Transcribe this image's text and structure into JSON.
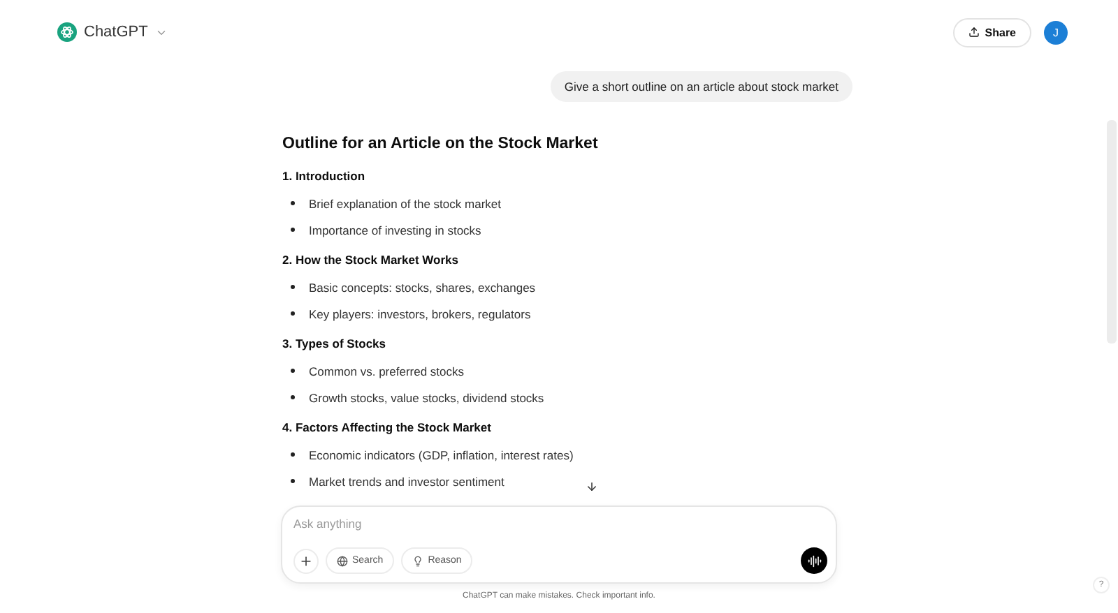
{
  "header": {
    "app_name": "ChatGPT",
    "share_label": "Share",
    "avatar_initial": "J"
  },
  "user_message": "Give a short outline on an article about stock market",
  "response": {
    "title": "Outline for an Article on the Stock Market",
    "sections": [
      {
        "heading": "1. Introduction",
        "bullets": [
          "Brief explanation of the stock market",
          "Importance of investing in stocks"
        ]
      },
      {
        "heading": "2. How the Stock Market Works",
        "bullets": [
          "Basic concepts: stocks, shares, exchanges",
          "Key players: investors, brokers, regulators"
        ]
      },
      {
        "heading": "3. Types of Stocks",
        "bullets": [
          "Common vs. preferred stocks",
          "Growth stocks, value stocks, dividend stocks"
        ]
      },
      {
        "heading": "4. Factors Affecting the Stock Market",
        "bullets": [
          "Economic indicators (GDP, inflation, interest rates)",
          "Market trends and investor sentiment"
        ]
      }
    ]
  },
  "composer": {
    "placeholder": "Ask anything",
    "tools": [
      "Search",
      "Reason"
    ]
  },
  "disclaimer": "ChatGPT can make mistakes. Check important info.",
  "help_label": "?"
}
